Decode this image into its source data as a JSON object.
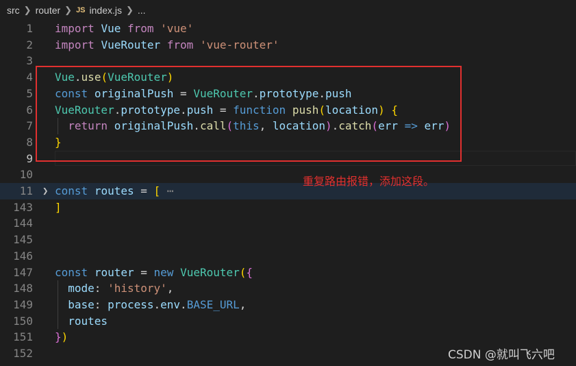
{
  "breadcrumb": {
    "items": [
      "src",
      "router",
      "index.js",
      "..."
    ],
    "file_icon": "JS"
  },
  "editor": {
    "line_numbers": [
      "1",
      "2",
      "3",
      "4",
      "5",
      "6",
      "7",
      "8",
      "9",
      "10",
      "11",
      "143",
      "144",
      "145",
      "146",
      "147",
      "148",
      "149",
      "150",
      "151",
      "152"
    ],
    "lines": [
      [
        [
          "kw-ctrl",
          "import"
        ],
        [
          "punc",
          " "
        ],
        [
          "var",
          "Vue"
        ],
        [
          "punc",
          " "
        ],
        [
          "kw-ctrl",
          "from"
        ],
        [
          "punc",
          " "
        ],
        [
          "str",
          "'vue'"
        ]
      ],
      [
        [
          "kw-ctrl",
          "import"
        ],
        [
          "punc",
          " "
        ],
        [
          "var",
          "VueRouter"
        ],
        [
          "punc",
          " "
        ],
        [
          "kw-ctrl",
          "from"
        ],
        [
          "punc",
          " "
        ],
        [
          "str",
          "'vue-router'"
        ]
      ],
      [],
      [
        [
          "cls",
          "Vue"
        ],
        [
          "punc",
          "."
        ],
        [
          "fn",
          "use"
        ],
        [
          "br1",
          "("
        ],
        [
          "cls",
          "VueRouter"
        ],
        [
          "br1",
          ")"
        ]
      ],
      [
        [
          "kw",
          "const"
        ],
        [
          "punc",
          " "
        ],
        [
          "var",
          "originalPush"
        ],
        [
          "punc",
          " = "
        ],
        [
          "cls",
          "VueRouter"
        ],
        [
          "punc",
          "."
        ],
        [
          "var",
          "prototype"
        ],
        [
          "punc",
          "."
        ],
        [
          "var",
          "push"
        ]
      ],
      [
        [
          "cls",
          "VueRouter"
        ],
        [
          "punc",
          "."
        ],
        [
          "var",
          "prototype"
        ],
        [
          "punc",
          "."
        ],
        [
          "var",
          "push"
        ],
        [
          "punc",
          " = "
        ],
        [
          "kw",
          "function"
        ],
        [
          "punc",
          " "
        ],
        [
          "fn",
          "push"
        ],
        [
          "br1",
          "("
        ],
        [
          "var",
          "location"
        ],
        [
          "br1",
          ")"
        ],
        [
          "punc",
          " "
        ],
        [
          "br1",
          "{"
        ]
      ],
      [
        [
          "punc",
          "  "
        ],
        [
          "kw-ctrl",
          "return"
        ],
        [
          "punc",
          " "
        ],
        [
          "var",
          "originalPush"
        ],
        [
          "punc",
          "."
        ],
        [
          "fn",
          "call"
        ],
        [
          "br2",
          "("
        ],
        [
          "kw",
          "this"
        ],
        [
          "punc",
          ", "
        ],
        [
          "var",
          "location"
        ],
        [
          "br2",
          ")"
        ],
        [
          "punc",
          "."
        ],
        [
          "fn",
          "catch"
        ],
        [
          "br2",
          "("
        ],
        [
          "var",
          "err"
        ],
        [
          "punc",
          " "
        ],
        [
          "kw",
          "=>"
        ],
        [
          "punc",
          " "
        ],
        [
          "var",
          "err"
        ],
        [
          "br2",
          ")"
        ]
      ],
      [
        [
          "br1",
          "}"
        ]
      ],
      [],
      [],
      [
        [
          "kw",
          "const"
        ],
        [
          "punc",
          " "
        ],
        [
          "var",
          "routes"
        ],
        [
          "punc",
          " = "
        ],
        [
          "br1",
          "["
        ],
        [
          "punc",
          " "
        ],
        [
          "fold-dots",
          "⋯"
        ]
      ],
      [
        [
          "br1",
          "]"
        ]
      ],
      [],
      [],
      [],
      [
        [
          "kw",
          "const"
        ],
        [
          "punc",
          " "
        ],
        [
          "var",
          "router"
        ],
        [
          "punc",
          " = "
        ],
        [
          "kw",
          "new"
        ],
        [
          "punc",
          " "
        ],
        [
          "cls",
          "VueRouter"
        ],
        [
          "br1",
          "("
        ],
        [
          "br2",
          "{"
        ]
      ],
      [
        [
          "punc",
          "  "
        ],
        [
          "var",
          "mode"
        ],
        [
          "punc",
          ": "
        ],
        [
          "str",
          "'history'"
        ],
        [
          "punc",
          ","
        ]
      ],
      [
        [
          "punc",
          "  "
        ],
        [
          "var",
          "base"
        ],
        [
          "punc",
          ": "
        ],
        [
          "var",
          "process"
        ],
        [
          "punc",
          "."
        ],
        [
          "var",
          "env"
        ],
        [
          "punc",
          "."
        ],
        [
          "kw",
          "BASE_URL"
        ],
        [
          "punc",
          ","
        ]
      ],
      [
        [
          "punc",
          "  "
        ],
        [
          "var",
          "routes"
        ]
      ],
      [
        [
          "br2",
          "}"
        ],
        [
          "br1",
          ")"
        ]
      ],
      [
        [
          "punc",
          "  "
        ],
        [
          "punc",
          " "
        ]
      ]
    ]
  },
  "annotation": "重复路由报错，添加这段。",
  "watermark": "CSDN @就叫飞六吧",
  "colors": {
    "highlight_box": "#e2302f",
    "annotation": "#e2302f",
    "background": "#1e1e1e"
  }
}
